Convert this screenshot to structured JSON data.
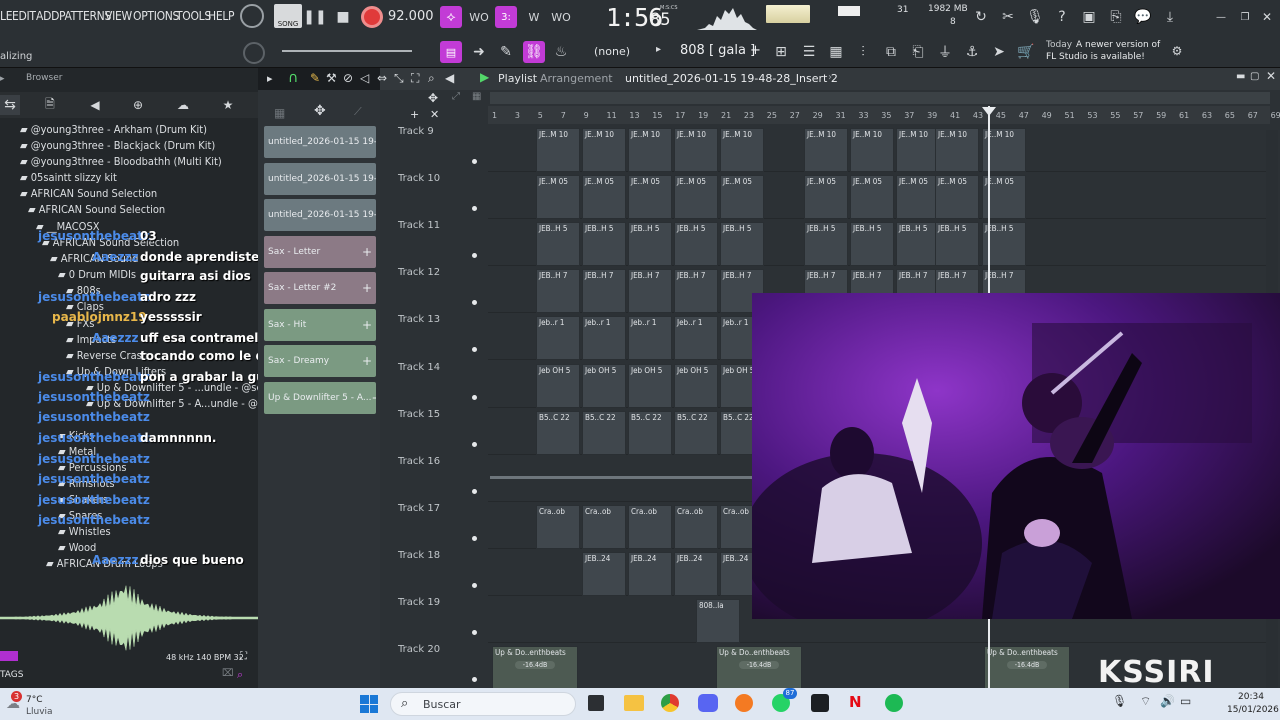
{
  "menu": {
    "file": "LE",
    "edit": "EDIT",
    "add": "ADD",
    "patterns": "PATTERNS",
    "view": "VIEW",
    "options": "OPTIONS",
    "tools": "TOOLS",
    "help": "HELP"
  },
  "transport": {
    "mode": "SONG",
    "bpm": "92.000",
    "time": "1:56",
    "time_small": "85",
    "time_unit": "M:S:CS"
  },
  "status": {
    "cpu": "31",
    "memory": "1982 MB",
    "poly": "8",
    "hint": "alizing",
    "pattern_selector": "808 [ gala ]",
    "none_label": "(none)",
    "update_date": "Today",
    "update_line1": "A newer version of",
    "update_line2": "FL Studio is available!"
  },
  "browser": {
    "title": "Browser",
    "tree": [
      "@young3three - Arkham (Drum Kit)",
      "@young3three - Blackjack (Drum Kit)",
      "@young3three - Bloodbathh (Multi Kit)",
      "05saintt slizzy kit",
      "AFRICAN Sound Selection",
      "AFRICAN Sound Selection",
      "__MACOSX",
      "AFRICAN Sound Selection",
      "AFRICAN Sound",
      "0 Drum MIDIs",
      "808s",
      "Claps",
      "FXs",
      "Impacts",
      "Reverse Crash",
      "Up & Down Lifters",
      "Up & Downlifter 5 - ...undle - @seventhbeats",
      "Up & Downlifter 5 - A...undle - @seventhbeats",
      "Kicks",
      "Metal",
      "Percussions",
      "Rimshots",
      "Shakers",
      "Snares",
      "Whistles",
      "Wood",
      "AFRICAN Drum Loops"
    ],
    "sample_info": "48 kHz 140 BPM 32",
    "tags_label": "TAGS"
  },
  "chat": [
    {
      "user": "jesusonthebeatz",
      "msg": "03"
    },
    {
      "user": "Aaezzz",
      "msg": "donde aprendiste a tocar la"
    },
    {
      "user": "",
      "msg": "guitarra asi dios"
    },
    {
      "user": "jesusonthebeatz",
      "msg": "adro zzz"
    },
    {
      "user": "paablojmnz19",
      "msg": "yesssssir"
    },
    {
      "user": "Aaezzz",
      "msg": "uff esa contramelodia que esta"
    },
    {
      "user": "",
      "msg": "tocando como le queda"
    },
    {
      "user": "jesusonthebeatz",
      "msg": "pon a grabar la guitar ad"
    },
    {
      "user": "jesusonthebeatz",
      "msg": ""
    },
    {
      "user": "jesusonthebeatz",
      "msg": ""
    },
    {
      "user": "jesusonthebeatz",
      "msg": "damnnnnn."
    },
    {
      "user": "jesusonthebeatz",
      "msg": ""
    },
    {
      "user": "jesusonthebeatz",
      "msg": ""
    },
    {
      "user": "jesusonthebeatz",
      "msg": ""
    },
    {
      "user": "jesusonthebeatz",
      "msg": ""
    },
    {
      "user": "Aaezzz",
      "msg": "dios que bueno"
    }
  ],
  "channels": [
    {
      "label": "untitled_2026-01-15 19-..."
    },
    {
      "label": "untitled_2026-01-15 19-..."
    },
    {
      "label": "untitled_2026-01-15 19-..."
    },
    {
      "label": "Sax - Letter"
    },
    {
      "label": "Sax - Letter #2"
    },
    {
      "label": "Sax - Hit"
    },
    {
      "label": "Sax - Dreamy"
    },
    {
      "label": "Up & Downlifter 5 - A..."
    }
  ],
  "playlist": {
    "title": "Playlist",
    "subtitle": "Arrangement",
    "file": "untitled_2026-01-15 19-48-28_Insert 2",
    "ruler": [
      "1",
      "3",
      "5",
      "7",
      "9",
      "11",
      "13",
      "15",
      "17",
      "19",
      "21",
      "23",
      "25",
      "27",
      "29",
      "31",
      "33",
      "35",
      "37",
      "39",
      "41",
      "43",
      "45",
      "47",
      "49",
      "51",
      "53",
      "55",
      "57",
      "59",
      "61",
      "63",
      "65",
      "67",
      "69"
    ],
    "tracks": [
      {
        "name": "Track 9",
        "clip": "JE..M 10"
      },
      {
        "name": "Track 10",
        "clip": "JE..M 05"
      },
      {
        "name": "Track 11",
        "clip": "JEB..H 5"
      },
      {
        "name": "Track 12",
        "clip": "JEB..H 7"
      },
      {
        "name": "Track 13",
        "clip": "Jeb..r 1"
      },
      {
        "name": "Track 14",
        "clip": "Jeb OH 5"
      },
      {
        "name": "Track 15",
        "clip": "B5..C 22"
      },
      {
        "name": "Track 16",
        "clip": ""
      },
      {
        "name": "Track 17",
        "clip": "Cra..ob"
      },
      {
        "name": "Track 18",
        "clip": "JEB..24"
      },
      {
        "name": "Track 19",
        "clip": "808..la"
      },
      {
        "name": "Track 20",
        "clip": "Up & Do..enthbeats"
      }
    ],
    "clip_db": "-16.4dB"
  },
  "overlay": {
    "watermark": "KSSIRI"
  },
  "taskbar": {
    "weather_temp": "7°C",
    "weather_desc": "Lluvia",
    "weather_badge": "3",
    "search_placeholder": "Buscar",
    "time": "20:34",
    "date": "15/01/2026",
    "badge_count": "87"
  },
  "colors": {
    "accent": "#c23bd6",
    "record": "#e03a3a",
    "play_green": "#4ec24e",
    "chat_user": "#4b8be9"
  }
}
